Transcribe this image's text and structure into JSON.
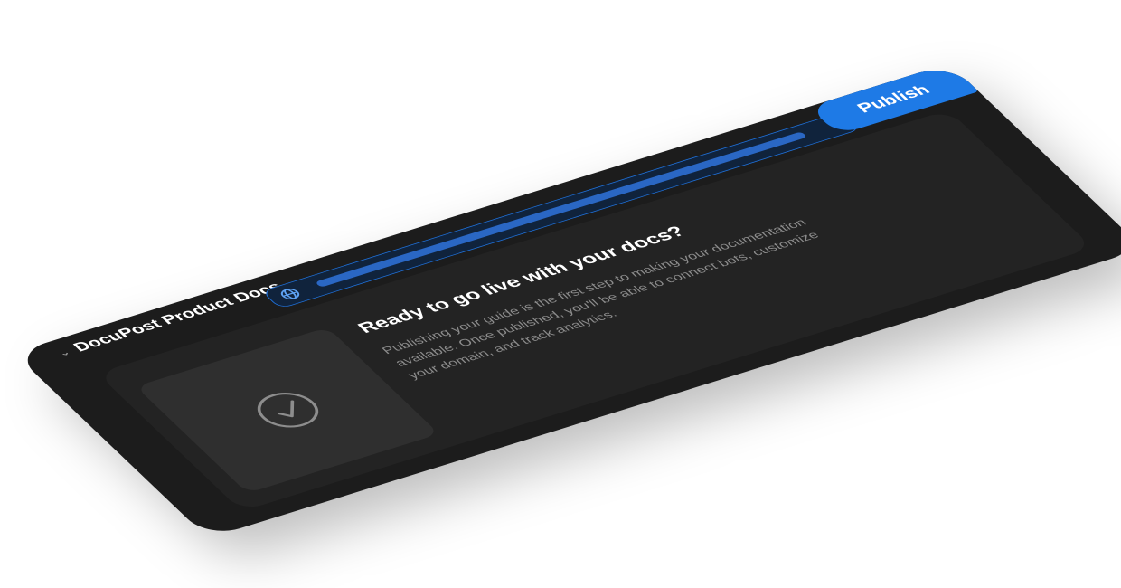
{
  "app": {
    "name": "DocuPost Product Docs",
    "publish_label": "Publish"
  },
  "url_bar": {
    "icon": "globe-icon"
  },
  "empty_state": {
    "icon": "check-circle-icon",
    "title": "Ready to go live with your docs?",
    "description": "Publishing your guide is the first step to making your documentation available. Once published, you'll be able to connect bots, customize your domain, and track analytics."
  },
  "colors": {
    "accent": "#1e7ae6",
    "card_bg": "#1c1c1c",
    "panel_bg": "#232323",
    "thumb_bg": "#2f2f2f",
    "url_bar_border": "#1f6fd6",
    "text_primary": "#ffffff",
    "text_secondary": "#8c8c8c"
  }
}
